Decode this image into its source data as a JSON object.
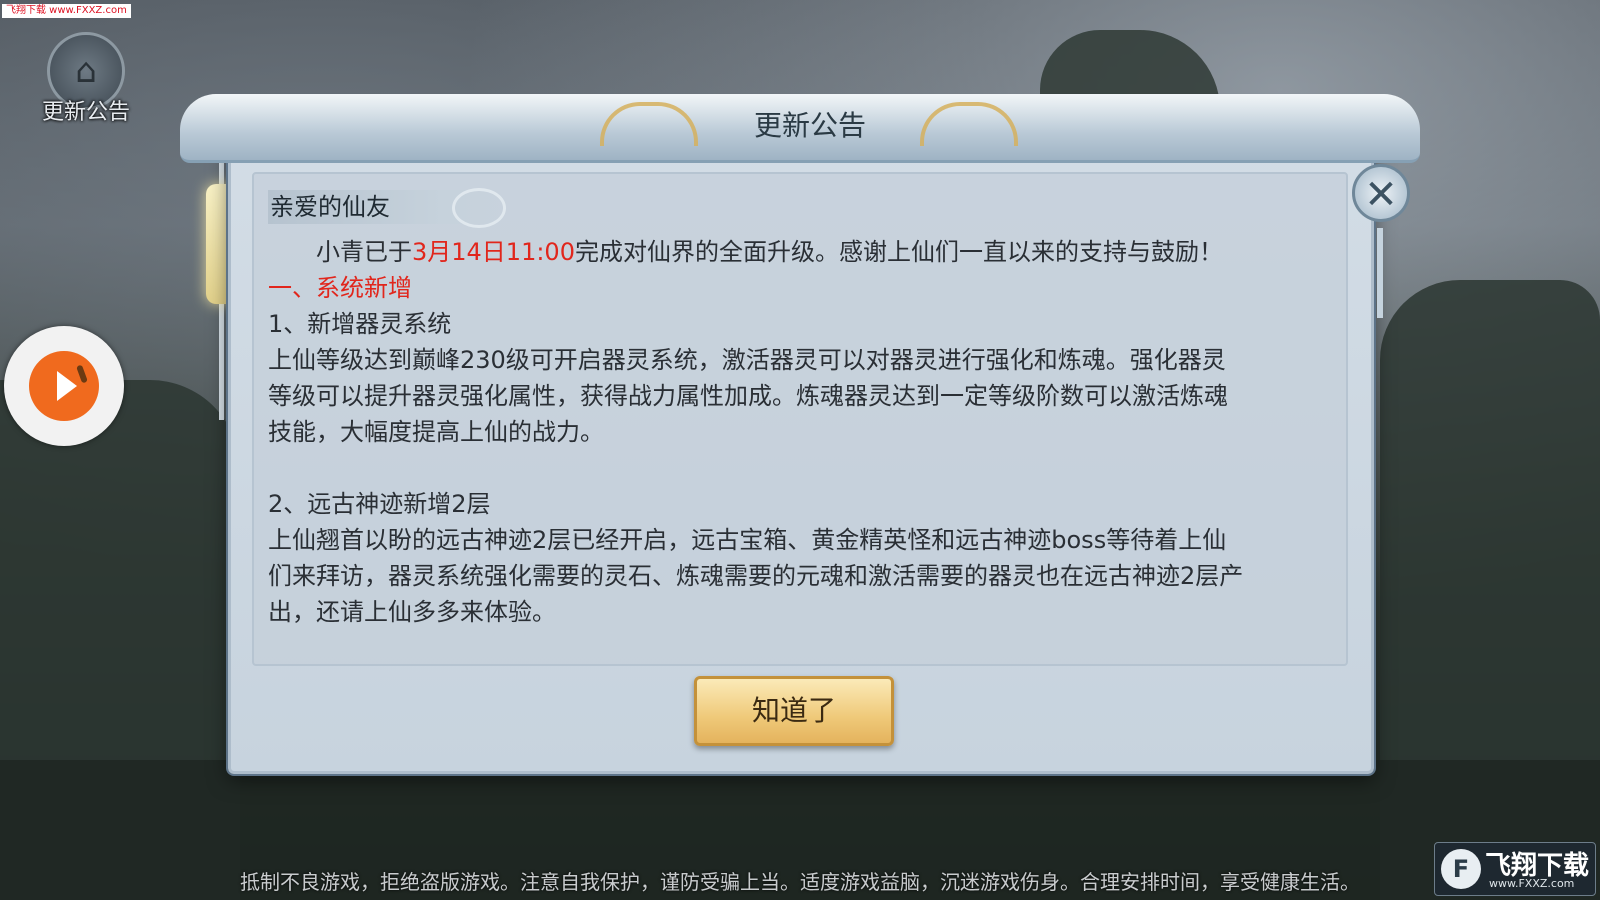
{
  "watermark_top": "飞翔下载 www.FXXZ.com",
  "side": {
    "notice_label": "更新公告"
  },
  "dialog": {
    "title": "更新公告",
    "greeting": "亲爱的仙友",
    "intro_before": "小青已于",
    "intro_time": "3月14日11:00",
    "intro_after": "完成对仙界的全面升级。感谢上仙们一直以来的支持与鼓励！",
    "section_title": "一、系统新增",
    "item1_title": "1、新增器灵系统",
    "item1_lines": [
      "上仙等级达到巅峰230级可开启器灵系统，激活器灵可以对器灵进行强化和炼魂。强化器灵",
      "等级可以提升器灵强化属性，获得战力属性加成。炼魂器灵达到一定等级阶数可以激活炼魂",
      "技能，大幅度提高上仙的战力。"
    ],
    "item2_title": "2、远古神迹新增2层",
    "item2_lines": [
      "上仙翘首以盼的远古神迹2层已经开启，远古宝箱、黄金精英怪和远古神迹boss等待着上仙",
      "们来拜访，器灵系统强化需要的灵石、炼魂需要的元魂和激活需要的器灵也在远古神迹2层产",
      "出，还请上仙多多来体验。"
    ],
    "ok_label": "知道了",
    "close_symbol": "✕"
  },
  "footer": "抵制不良游戏，拒绝盗版游戏。注意自我保护，谨防受骗上当。适度游戏益脑，沉迷游戏伤身。合理安排时间，享受健康生活。",
  "logo": {
    "badge": "F",
    "name": "飞翔下载",
    "url": "www.FXXZ.com"
  }
}
